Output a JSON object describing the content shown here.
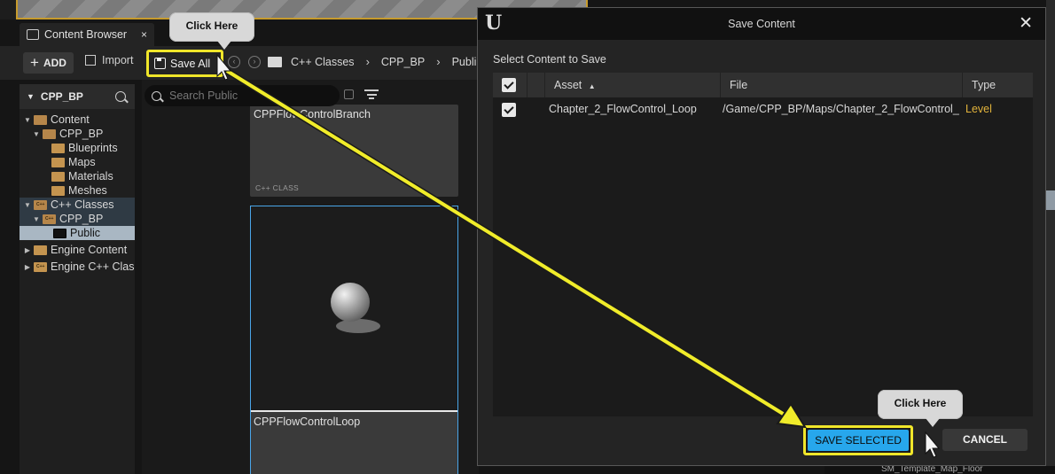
{
  "content_browser": {
    "tab_title": "Content Browser",
    "tab_close": "×",
    "add_label": "ADD",
    "import_label": "Import",
    "save_all_label": "Save All",
    "breadcrumbs": [
      "C++ Classes",
      "CPP_BP",
      "Publi"
    ],
    "search_placeholder": "Search Public",
    "tree_root": "CPP_BP",
    "tree": [
      {
        "label": "Content"
      },
      {
        "label": "CPP_BP"
      },
      {
        "label": "Blueprints"
      },
      {
        "label": "Maps"
      },
      {
        "label": "Materials"
      },
      {
        "label": "Meshes"
      },
      {
        "label": "C++ Classes"
      },
      {
        "label": "CPP_BP"
      },
      {
        "label": "Public"
      },
      {
        "label": "Engine Content"
      },
      {
        "label": "Engine C++ Clas"
      }
    ],
    "tiles": [
      {
        "name": "CPPFlowControlBranch",
        "kind": "C++ CLASS"
      },
      {
        "name": "CPPFlowControlLoop"
      }
    ]
  },
  "dialog": {
    "title": "Save Content",
    "close": "✕",
    "subtitle": "Select Content to Save",
    "columns": {
      "asset": "Asset",
      "file": "File",
      "type": "Type"
    },
    "rows": [
      {
        "asset": "Chapter_2_FlowControl_Loop",
        "file": "/Game/CPP_BP/Maps/Chapter_2_FlowControl_",
        "type": "Level",
        "checked": true
      }
    ],
    "save_selected_label": "SAVE SELECTED",
    "cancel_label": "CANCEL"
  },
  "callouts": {
    "save_all": "Click Here",
    "save_selected": "Click Here"
  },
  "background": {
    "bottom_text": "SM_Template_Map_Floor"
  },
  "colors": {
    "highlight": "#f0e62a",
    "accent_blue": "#27a7ec",
    "level_type": "#e2b33b"
  }
}
